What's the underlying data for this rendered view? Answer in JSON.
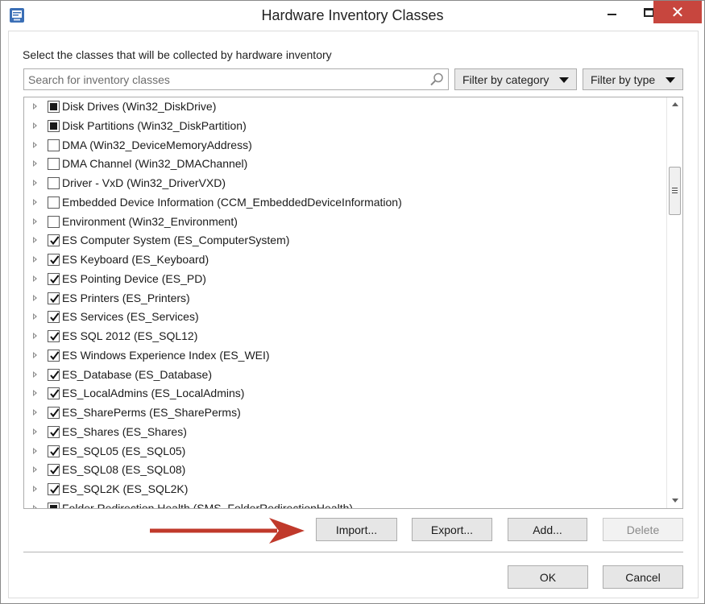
{
  "window": {
    "title": "Hardware Inventory Classes",
    "close_glyph": "✕"
  },
  "instruction": "Select the classes that will be collected by hardware inventory",
  "search": {
    "placeholder": "Search for inventory classes",
    "value": ""
  },
  "filters": {
    "category_label": "Filter by category",
    "type_label": "Filter by type"
  },
  "classes": [
    {
      "label": "Disk Drives (Win32_DiskDrive)",
      "state": "partial"
    },
    {
      "label": "Disk Partitions (Win32_DiskPartition)",
      "state": "partial"
    },
    {
      "label": "DMA (Win32_DeviceMemoryAddress)",
      "state": "unchecked"
    },
    {
      "label": "DMA Channel (Win32_DMAChannel)",
      "state": "unchecked"
    },
    {
      "label": "Driver - VxD (Win32_DriverVXD)",
      "state": "unchecked"
    },
    {
      "label": "Embedded Device Information (CCM_EmbeddedDeviceInformation)",
      "state": "unchecked"
    },
    {
      "label": "Environment (Win32_Environment)",
      "state": "unchecked"
    },
    {
      "label": "ES Computer System (ES_ComputerSystem)",
      "state": "checked"
    },
    {
      "label": "ES Keyboard (ES_Keyboard)",
      "state": "checked"
    },
    {
      "label": "ES Pointing Device (ES_PD)",
      "state": "checked"
    },
    {
      "label": "ES Printers (ES_Printers)",
      "state": "checked"
    },
    {
      "label": "ES Services (ES_Services)",
      "state": "checked"
    },
    {
      "label": "ES SQL 2012 (ES_SQL12)",
      "state": "checked"
    },
    {
      "label": "ES Windows Experience Index (ES_WEI)",
      "state": "checked"
    },
    {
      "label": "ES_Database (ES_Database)",
      "state": "checked"
    },
    {
      "label": "ES_LocalAdmins (ES_LocalAdmins)",
      "state": "checked"
    },
    {
      "label": "ES_SharePerms (ES_SharePerms)",
      "state": "checked"
    },
    {
      "label": "ES_Shares (ES_Shares)",
      "state": "checked"
    },
    {
      "label": "ES_SQL05 (ES_SQL05)",
      "state": "checked"
    },
    {
      "label": "ES_SQL08 (ES_SQL08)",
      "state": "checked"
    },
    {
      "label": "ES_SQL2K (ES_SQL2K)",
      "state": "checked"
    },
    {
      "label": "Folder Redirection Health (SMS_FolderRedirectionHealth)",
      "state": "partial"
    }
  ],
  "buttons": {
    "import": "Import...",
    "export": "Export...",
    "add": "Add...",
    "delete": "Delete",
    "ok": "OK",
    "cancel": "Cancel"
  },
  "colors": {
    "close_button": "#c7463e",
    "annotation_arrow": "#c0392b"
  },
  "icons": {
    "app": "app-icon",
    "search": "search-icon",
    "expander": "expand-triangle-icon"
  }
}
